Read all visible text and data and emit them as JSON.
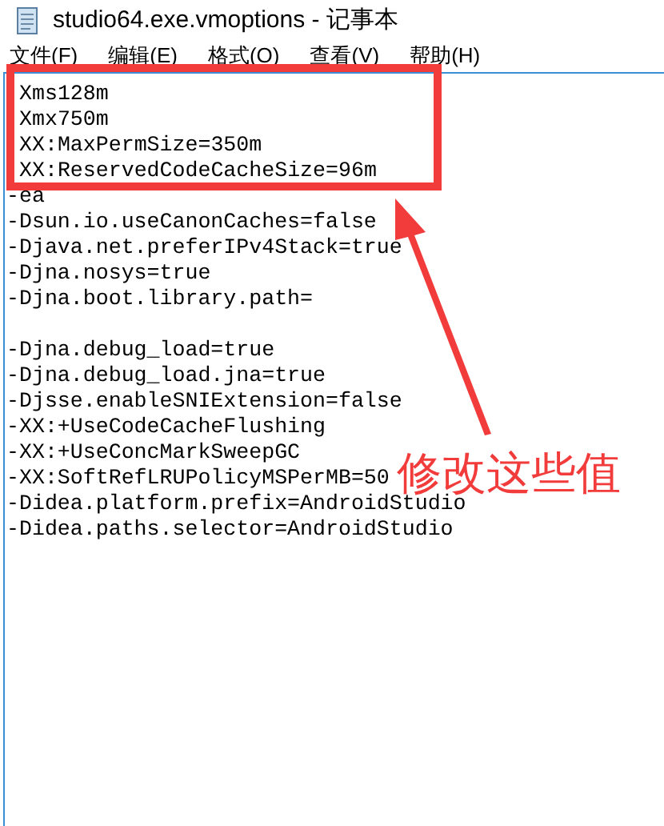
{
  "window": {
    "title": "studio64.exe.vmoptions - 记事本"
  },
  "menu": [
    "文件(F)",
    "编辑(E)",
    "格式(O)",
    "查看(V)",
    "帮助(H)"
  ],
  "editor": {
    "highlighted_lines": [
      "Xms128m",
      "Xmx750m",
      "XX:MaxPermSize=350m",
      "XX:ReservedCodeCacheSize=96m"
    ],
    "line_groups": [
      [
        "-ea",
        "-Dsun.io.useCanonCaches=false",
        "-Djava.net.preferIPv4Stack=true",
        "-Djna.nosys=true",
        "-Djna.boot.library.path="
      ],
      [
        "-Djna.debug_load=true",
        "-Djna.debug_load.jna=true",
        "-Djsse.enableSNIExtension=false",
        "-XX:+UseCodeCacheFlushing",
        "-XX:+UseConcMarkSweepGC",
        "-XX:SoftRefLRUPolicyMSPerMB=50",
        "-Didea.platform.prefix=AndroidStudio",
        "-Didea.paths.selector=AndroidStudio"
      ]
    ]
  },
  "annotation": {
    "label": "修改这些值"
  }
}
